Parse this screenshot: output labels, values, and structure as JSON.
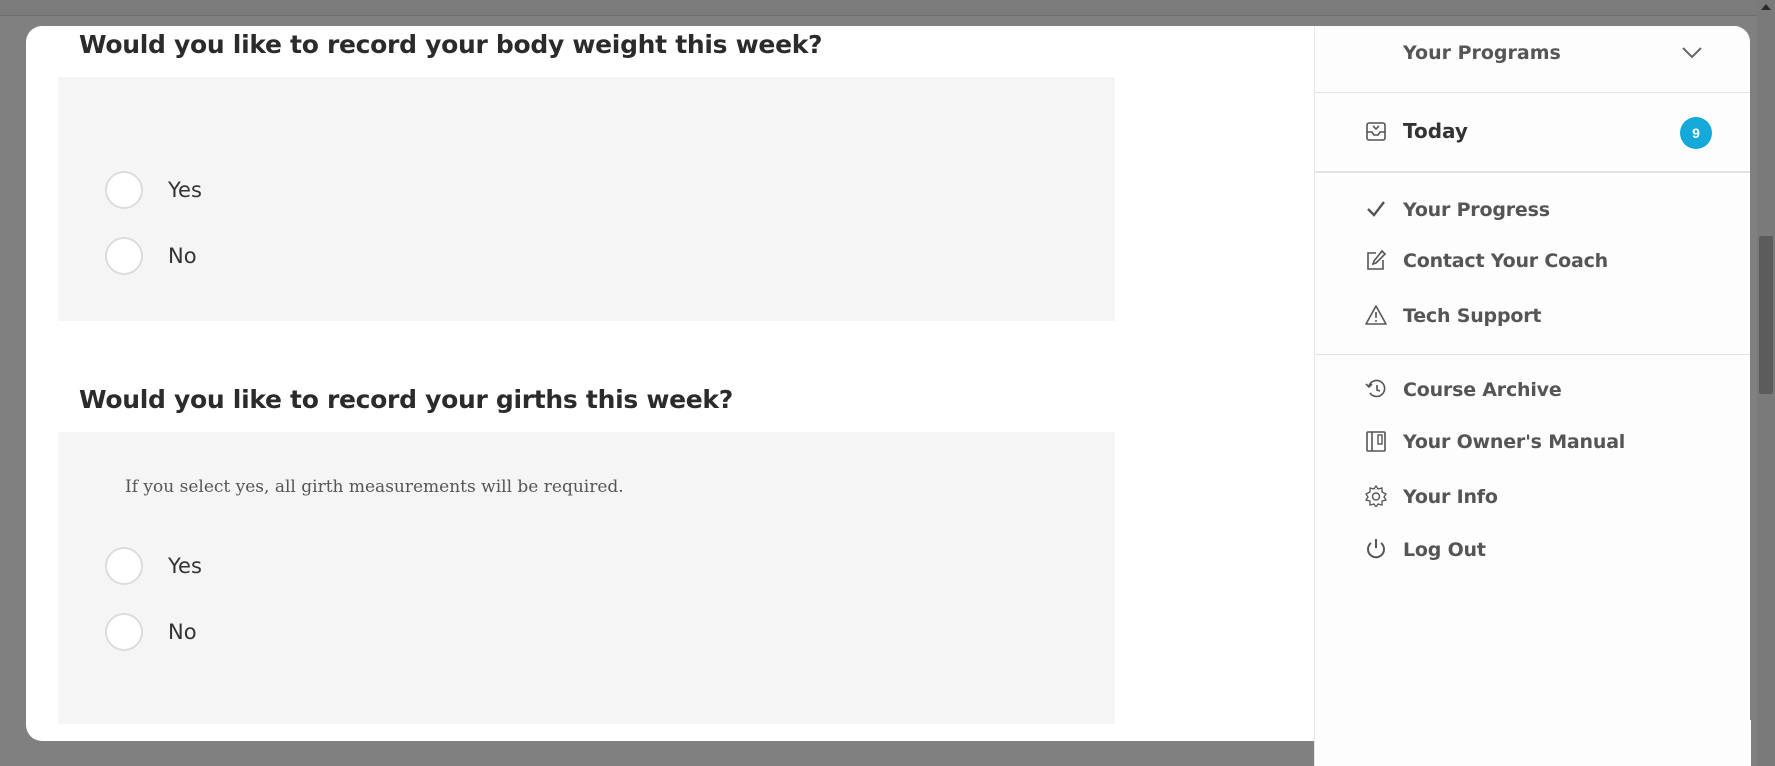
{
  "questions": [
    {
      "title": "Would you like to record your body weight this week?",
      "note": "",
      "options": [
        "Yes",
        "No"
      ]
    },
    {
      "title": "Would you like to record your girths this week?",
      "note": "If you select yes, all girth measurements will be required.",
      "options": [
        "Yes",
        "No"
      ]
    }
  ],
  "sidebar": {
    "programs_label": "Your Programs",
    "today": {
      "label": "Today",
      "badge": "9",
      "badge_color": "#14a9d8"
    },
    "group1": [
      {
        "label": "Your Progress",
        "icon": "check-icon"
      },
      {
        "label": "Contact Your Coach",
        "icon": "pencil-square-icon"
      },
      {
        "label": "Tech Support",
        "icon": "warning-triangle-icon"
      }
    ],
    "group2": [
      {
        "label": "Course Archive",
        "icon": "history-icon"
      },
      {
        "label": "Your Owner's Manual",
        "icon": "manual-book-icon"
      },
      {
        "label": "Your Info",
        "icon": "gear-icon"
      },
      {
        "label": "Log Out",
        "icon": "power-icon"
      }
    ]
  }
}
